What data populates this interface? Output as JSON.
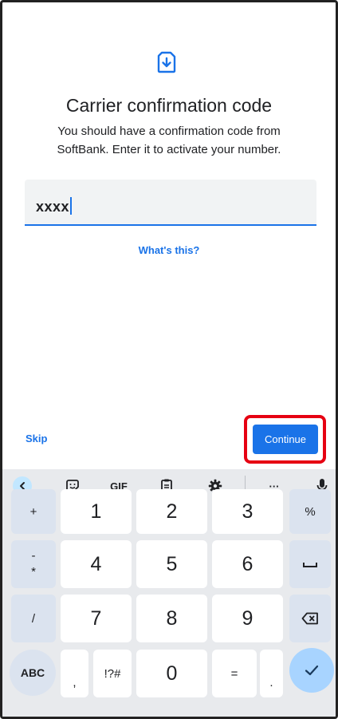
{
  "setup": {
    "title": "Carrier confirmation code",
    "subtitle": "You should have a confirmation code from SoftBank. Enter it to activate your number.",
    "code_value": "xxxx",
    "whats_this": "What's this?",
    "skip_label": "Skip",
    "continue_label": "Continue"
  },
  "keyboard": {
    "toolbar": {
      "gif": "GIF",
      "more": "···"
    },
    "keys": {
      "plus": "+",
      "minus": "-",
      "star": "*",
      "slash": "/",
      "k1": "1",
      "k2": "2",
      "k3": "3",
      "k4": "4",
      "k5": "5",
      "k6": "6",
      "k7": "7",
      "k8": "8",
      "k9": "9",
      "k0": "0",
      "comma": ",",
      "symbols": "!?#",
      "equals": "=",
      "period": ".",
      "percent": "%",
      "abc": "ABC"
    }
  },
  "colors": {
    "accent": "#1a73e8",
    "highlight": "#e60012"
  }
}
